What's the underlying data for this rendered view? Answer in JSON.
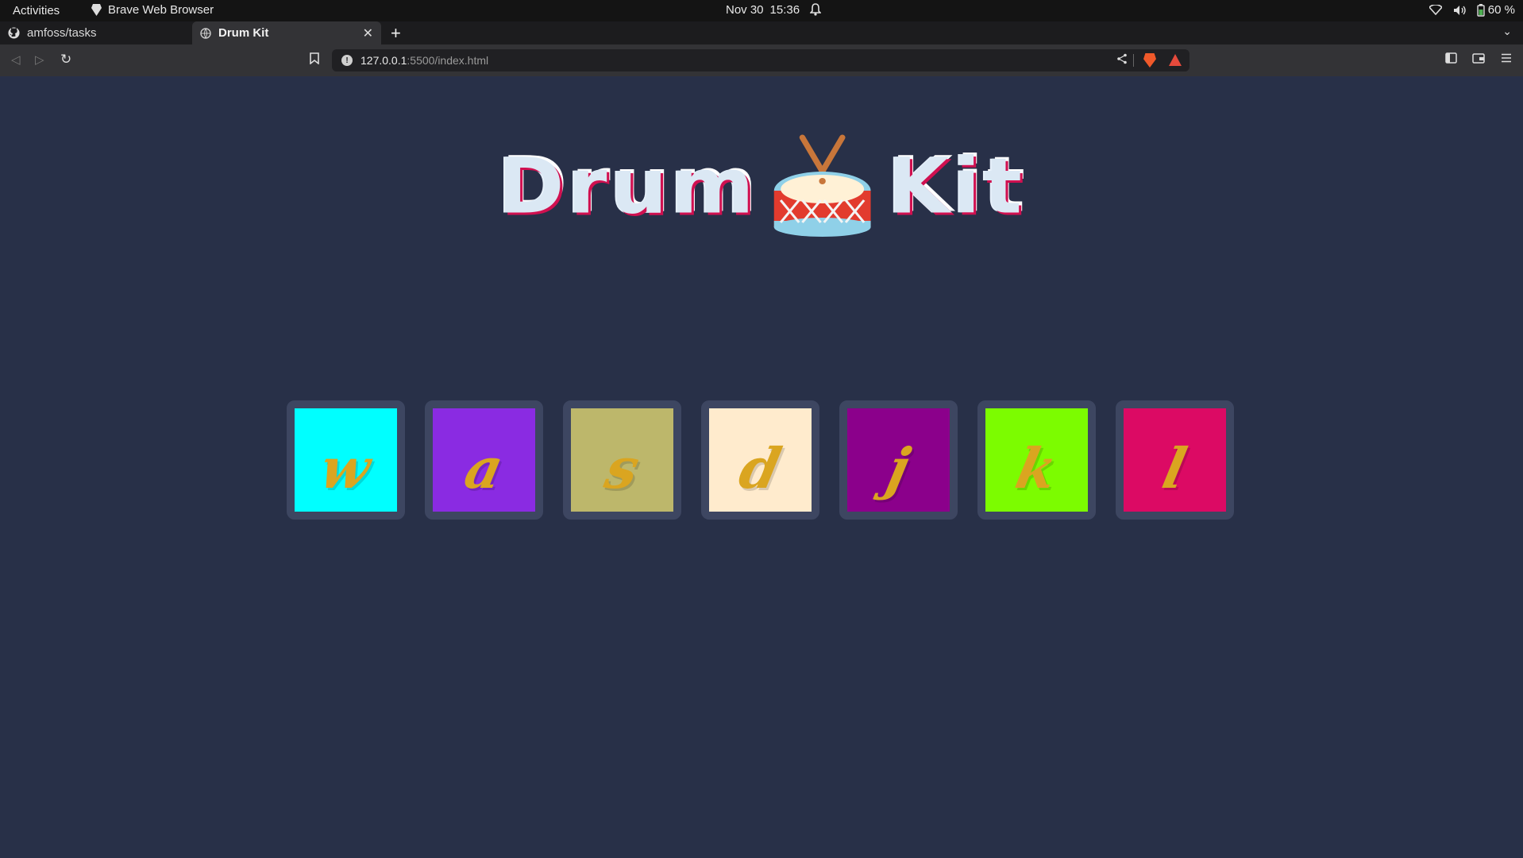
{
  "system_bar": {
    "activities": "Activities",
    "app_name": "Brave Web Browser",
    "date": "Nov 30",
    "time": "15:36",
    "battery": "60 %"
  },
  "tabs": [
    {
      "label": "amfoss/tasks",
      "icon": "github-icon",
      "active": false
    },
    {
      "label": "Drum Kit",
      "icon": "globe-icon",
      "active": true
    }
  ],
  "toolbar": {
    "url_host": "127.0.0.1",
    "url_path": ":5500/index.html"
  },
  "page": {
    "title_left": "Drum",
    "title_right": "Kit",
    "title_emoji": "drum-icon"
  },
  "drum_keys": [
    {
      "letter": "w",
      "color": "#00ffff"
    },
    {
      "letter": "a",
      "color": "#8a2be2"
    },
    {
      "letter": "s",
      "color": "#bdb76b"
    },
    {
      "letter": "d",
      "color": "#ffebcd"
    },
    {
      "letter": "j",
      "color": "#8b008b"
    },
    {
      "letter": "k",
      "color": "#7cfc00"
    },
    {
      "letter": "l",
      "color": "#dc0a64"
    }
  ],
  "colors": {
    "page_background": "#283048",
    "title_text": "#dbe8f4",
    "key_letter": "#daa520",
    "key_border": "#3d4661"
  }
}
